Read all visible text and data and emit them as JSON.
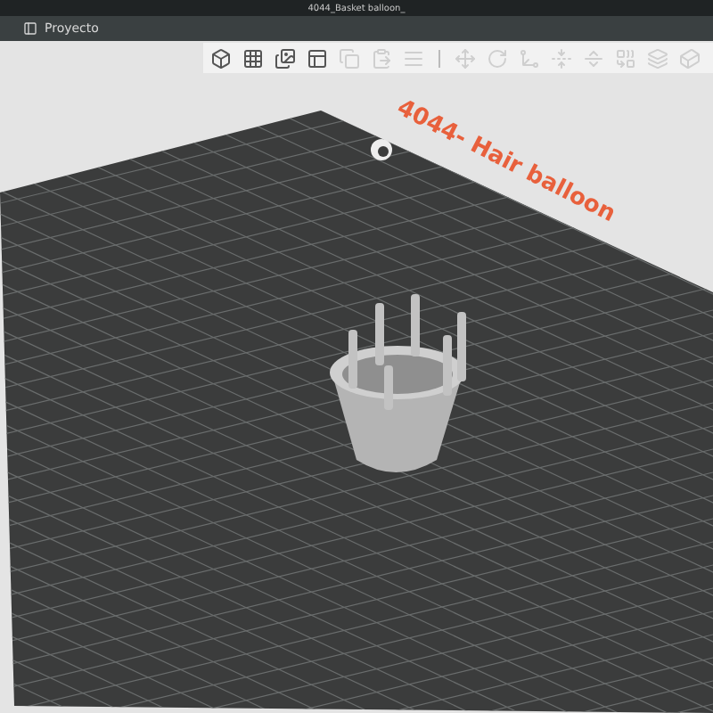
{
  "window": {
    "title": "4044_Basket balloon_"
  },
  "menu": {
    "label": "Proyecto"
  },
  "toolbar": [
    {
      "kind": "add-model",
      "disabled": false
    },
    {
      "kind": "grid",
      "disabled": false
    },
    {
      "kind": "import",
      "disabled": false
    },
    {
      "kind": "layout",
      "disabled": false
    },
    {
      "kind": "copy",
      "disabled": true
    },
    {
      "kind": "paste",
      "disabled": true
    },
    {
      "kind": "list",
      "disabled": true
    },
    {
      "kind": "separator"
    },
    {
      "kind": "move",
      "disabled": true
    },
    {
      "kind": "rotate",
      "disabled": true
    },
    {
      "kind": "scale",
      "disabled": true
    },
    {
      "kind": "flat",
      "disabled": true
    },
    {
      "kind": "cut",
      "disabled": true
    },
    {
      "kind": "merge",
      "disabled": true
    },
    {
      "kind": "support",
      "disabled": true
    },
    {
      "kind": "view",
      "disabled": true
    }
  ],
  "bed": {
    "label": "4044- Hair balloon"
  }
}
